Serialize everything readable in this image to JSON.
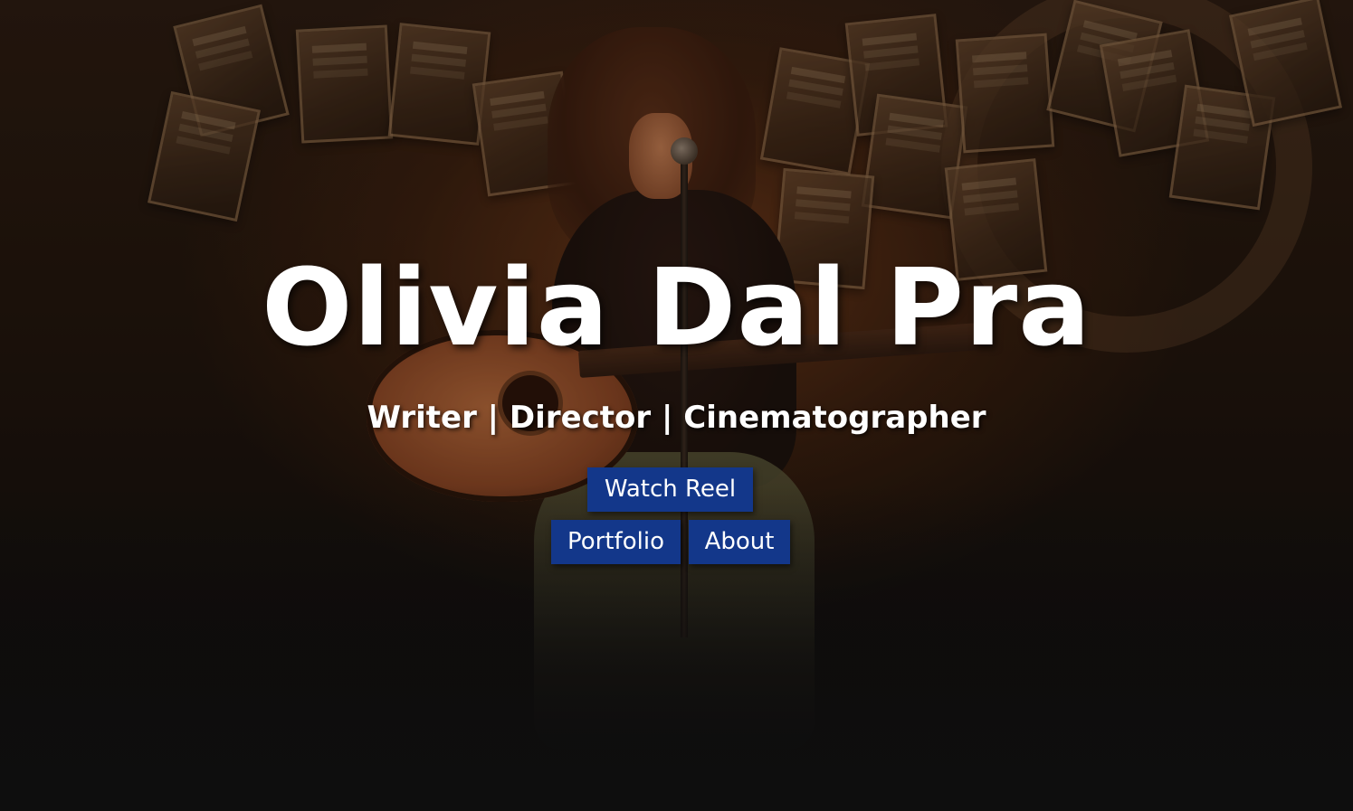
{
  "hero": {
    "title": "Olivia Dal Pra",
    "subtitle": "Writer | Director | Cinematographer",
    "background_image": "performer-with-acoustic-guitar-on-stage"
  },
  "buttons": {
    "watch_reel": "Watch Reel",
    "portfolio": "Portfolio",
    "about": "About"
  },
  "colors": {
    "button_bg": "#13378a",
    "text": "#ffffff",
    "background_dark": "#0e0e0e",
    "background_warm": "#7a3e1c"
  }
}
